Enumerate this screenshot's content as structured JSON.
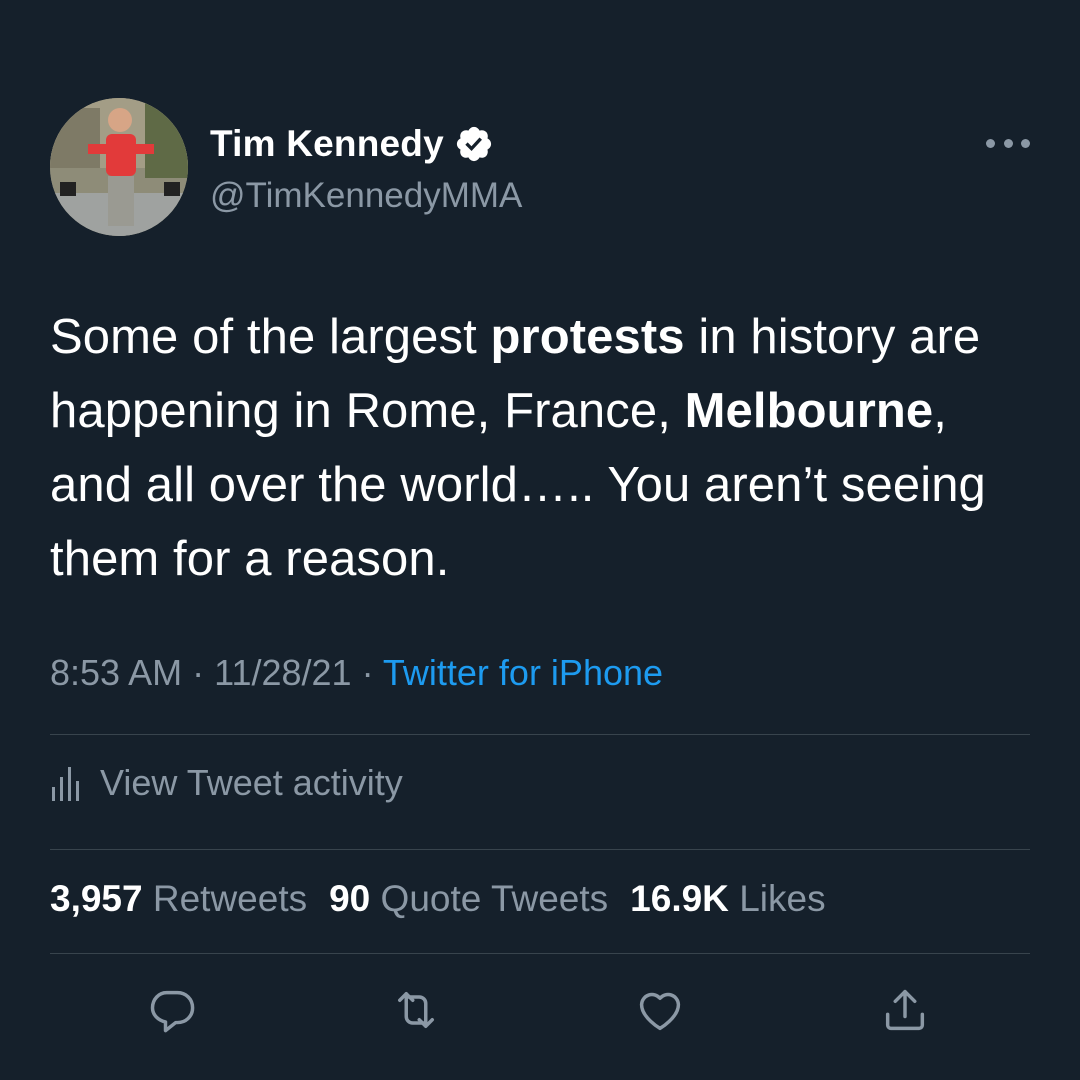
{
  "user": {
    "display_name": "Tim Kennedy",
    "handle": "@TimKennedyMMA"
  },
  "tweet": {
    "segments": [
      {
        "text": "Some of the largest ",
        "bold": false
      },
      {
        "text": "protests",
        "bold": true
      },
      {
        "text": " in history are happening in Rome, France, ",
        "bold": false
      },
      {
        "text": "Melbourne",
        "bold": true
      },
      {
        "text": ", and all over the world….. You aren’t seeing them for a reason.",
        "bold": false
      }
    ],
    "time": "8:53 AM",
    "separator": " · ",
    "date": "11/28/21",
    "source": "Twitter for iPhone"
  },
  "activity": {
    "label": "View Tweet activity"
  },
  "stats": {
    "retweets_count": "3,957",
    "retweets_label": "Retweets",
    "quotes_count": "90",
    "quotes_label": "Quote Tweets",
    "likes_count": "16.9K",
    "likes_label": "Likes"
  },
  "icons": {
    "verified": "verified-badge-icon",
    "more": "more-options-icon",
    "activity": "bar-chart-icon",
    "reply": "reply-icon",
    "retweet": "retweet-icon",
    "like": "heart-icon",
    "share": "share-icon"
  },
  "colors": {
    "background": "#15202b",
    "text_primary": "#ffffff",
    "text_secondary": "#8b98a5",
    "link": "#1d9bf0",
    "divider": "#38444d"
  }
}
